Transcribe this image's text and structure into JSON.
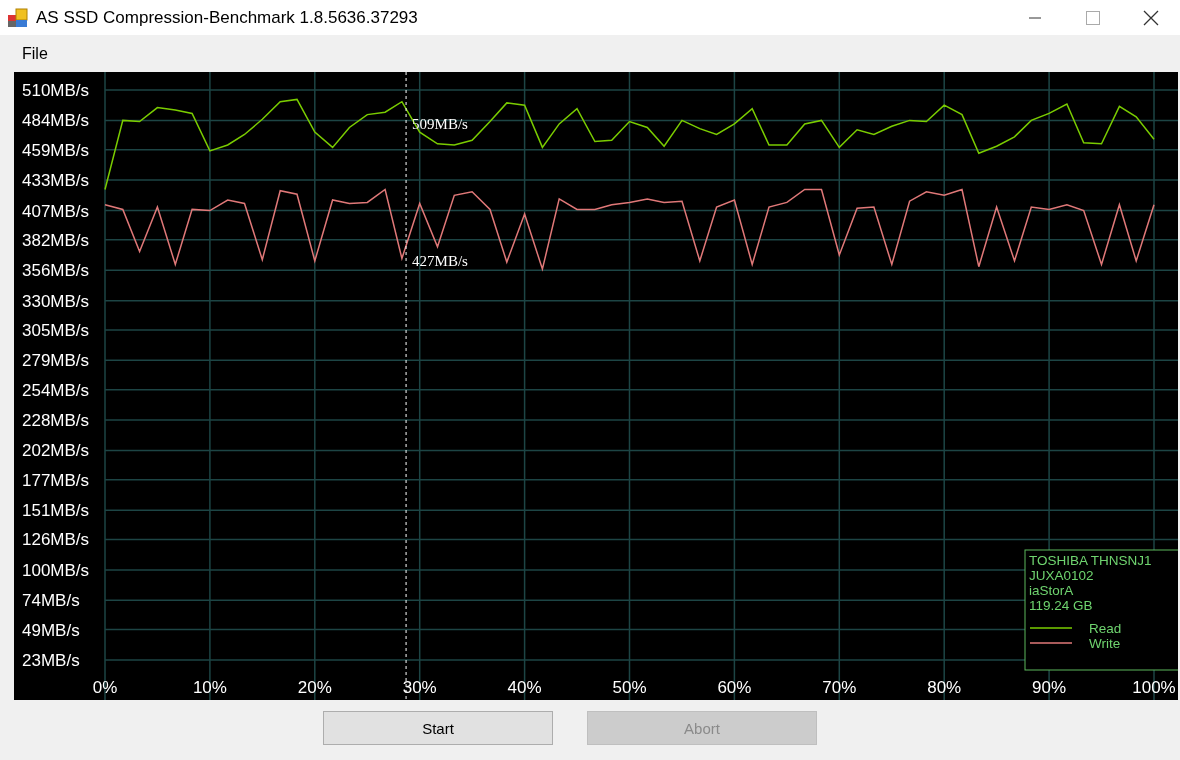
{
  "window": {
    "title": "AS SSD Compression-Benchmark 1.8.5636.37293"
  },
  "menu": [
    {
      "label": "File"
    }
  ],
  "chart_panel": {
    "chart_data": {
      "type": "line",
      "xlim": [
        0,
        100
      ],
      "ylim": [
        23,
        510
      ],
      "grid": true,
      "legend": true,
      "xticks": [
        {
          "value": 0,
          "label": "0%"
        },
        {
          "value": 10,
          "label": "10%"
        },
        {
          "value": 20,
          "label": "20%"
        },
        {
          "value": 30,
          "label": "30%"
        },
        {
          "value": 40,
          "label": "40%"
        },
        {
          "value": 50,
          "label": "50%"
        },
        {
          "value": 60,
          "label": "60%"
        },
        {
          "value": 70,
          "label": "70%"
        },
        {
          "value": 80,
          "label": "80%"
        },
        {
          "value": 90,
          "label": "90%"
        },
        {
          "value": 100,
          "label": "100%"
        }
      ],
      "yticks": [
        {
          "value": 510,
          "label": "510MB/s"
        },
        {
          "value": 484,
          "label": "484MB/s"
        },
        {
          "value": 459,
          "label": "459MB/s"
        },
        {
          "value": 433,
          "label": "433MB/s"
        },
        {
          "value": 407,
          "label": "407MB/s"
        },
        {
          "value": 382,
          "label": "382MB/s"
        },
        {
          "value": 356,
          "label": "356MB/s"
        },
        {
          "value": 330,
          "label": "330MB/s"
        },
        {
          "value": 305,
          "label": "305MB/s"
        },
        {
          "value": 279,
          "label": "279MB/s"
        },
        {
          "value": 254,
          "label": "254MB/s"
        },
        {
          "value": 228,
          "label": "228MB/s"
        },
        {
          "value": 202,
          "label": "202MB/s"
        },
        {
          "value": 177,
          "label": "177MB/s"
        },
        {
          "value": 151,
          "label": "151MB/s"
        },
        {
          "value": 126,
          "label": "126MB/s"
        },
        {
          "value": 100,
          "label": "100MB/s"
        },
        {
          "value": 74,
          "label": "74MB/s"
        },
        {
          "value": 49,
          "label": "49MB/s"
        },
        {
          "value": 23,
          "label": "23MB/s"
        }
      ],
      "x": [
        0,
        1.7,
        3.3,
        5,
        6.7,
        8.3,
        10,
        11.7,
        13.3,
        15,
        16.7,
        18.3,
        20,
        21.7,
        23.3,
        25,
        26.7,
        28.3,
        30,
        31.7,
        33.3,
        35,
        36.7,
        38.3,
        40,
        41.7,
        43.3,
        45,
        46.7,
        48.3,
        50,
        51.7,
        53.3,
        55,
        56.7,
        58.3,
        60,
        61.7,
        63.3,
        65,
        66.7,
        68.3,
        70,
        71.7,
        73.3,
        75,
        76.7,
        78.3,
        80,
        81.7,
        83.3,
        85,
        86.7,
        88.3,
        90,
        91.7,
        93.3,
        95,
        96.7,
        98.3,
        100
      ],
      "series": [
        {
          "name": "Read",
          "color": "#7acc00",
          "values": [
            425,
            484,
            483,
            495,
            493,
            490,
            458,
            463,
            472,
            485,
            500,
            502,
            474,
            461,
            478,
            489,
            491,
            500,
            474,
            464,
            463,
            467,
            483,
            499,
            497,
            461,
            481,
            494,
            466,
            467,
            483,
            478,
            462,
            484,
            477,
            472,
            481,
            494,
            463,
            463,
            481,
            484,
            461,
            476,
            472,
            479,
            484,
            483,
            497,
            489,
            456,
            462,
            470,
            484,
            490,
            498,
            465,
            464,
            496,
            487,
            468
          ]
        },
        {
          "name": "Write",
          "color": "#e07878",
          "values": [
            412,
            408,
            372,
            410,
            361,
            408,
            407,
            416,
            413,
            365,
            424,
            421,
            364,
            416,
            413,
            414,
            425,
            366,
            413,
            376,
            420,
            423,
            408,
            363,
            404,
            357,
            417,
            408,
            408,
            412,
            414,
            417,
            414,
            415,
            364,
            410,
            416,
            361,
            410,
            414,
            425,
            425,
            369,
            409,
            410,
            361,
            415,
            423,
            420,
            425,
            359,
            410,
            364,
            410,
            408,
            412,
            407,
            361,
            412,
            364,
            412
          ]
        }
      ],
      "ref_lines": [
        {
          "axis": "x",
          "value": 28.7
        }
      ],
      "annotations": [
        "509MB/s",
        "427MB/s"
      ]
    },
    "device_info": [
      "TOSHIBA THNSNJ1",
      "JUXA0102",
      "iaStorA",
      "119.24 GB"
    ]
  },
  "buttons": [
    {
      "label": "Start",
      "disabled": false
    },
    {
      "label": "Abort",
      "disabled": true
    }
  ]
}
